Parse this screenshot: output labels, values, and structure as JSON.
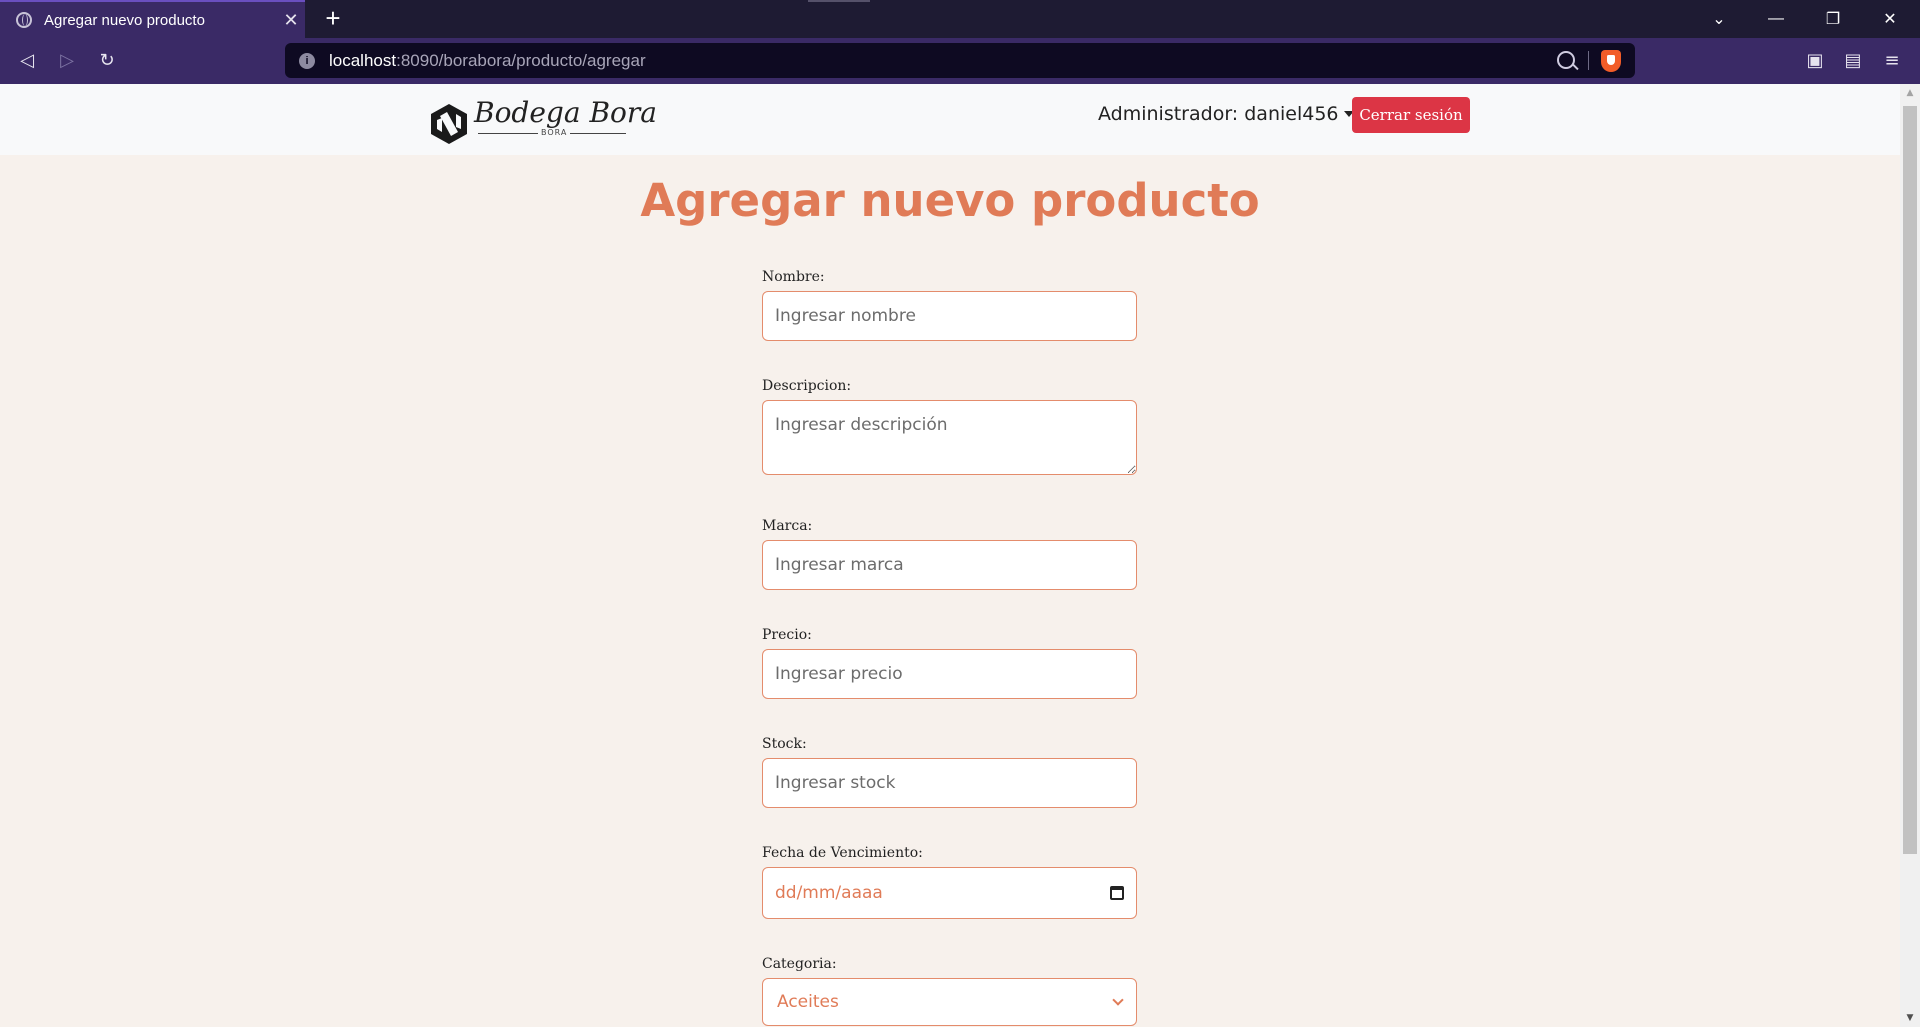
{
  "browser": {
    "tab_title": "Agregar nuevo producto",
    "tab_close": "✕",
    "new_tab": "+",
    "url_host": "localhost",
    "url_rest": ":8090/borabora/producto/agregar"
  },
  "header": {
    "logo_text": "Bodega Bora",
    "logo_sub": "BORA",
    "admin_label": "Administrador: daniel456",
    "logout_label": "Cerrar sesión"
  },
  "page": {
    "title": "Agregar nuevo producto"
  },
  "form": {
    "nombre": {
      "label": "Nombre:",
      "placeholder": "Ingresar nombre"
    },
    "descripcion": {
      "label": "Descripcion:",
      "placeholder": "Ingresar descripción"
    },
    "marca": {
      "label": "Marca:",
      "placeholder": "Ingresar marca"
    },
    "precio": {
      "label": "Precio:",
      "placeholder": "Ingresar precio"
    },
    "stock": {
      "label": "Stock:",
      "placeholder": "Ingresar stock"
    },
    "fecha": {
      "label": "Fecha de Vencimiento:",
      "placeholder": "dd/mm/aaaa"
    },
    "categoria": {
      "label": "Categoria:",
      "selected": "Aceites"
    }
  },
  "icons": {
    "globe": "globe-icon",
    "back": "back-icon",
    "forward": "forward-icon",
    "reload": "reload-icon",
    "zoom": "zoom-out-icon",
    "brave": "brave-shield-icon",
    "sidebar": "sidebar-icon",
    "wallet": "wallet-icon",
    "menu": "menu-icon",
    "calendar": "calendar-icon"
  },
  "colors": {
    "accent": "#e07b57",
    "danger": "#dc3545",
    "page_bg": "#f7f1ec",
    "chrome": "#3a2a66"
  }
}
